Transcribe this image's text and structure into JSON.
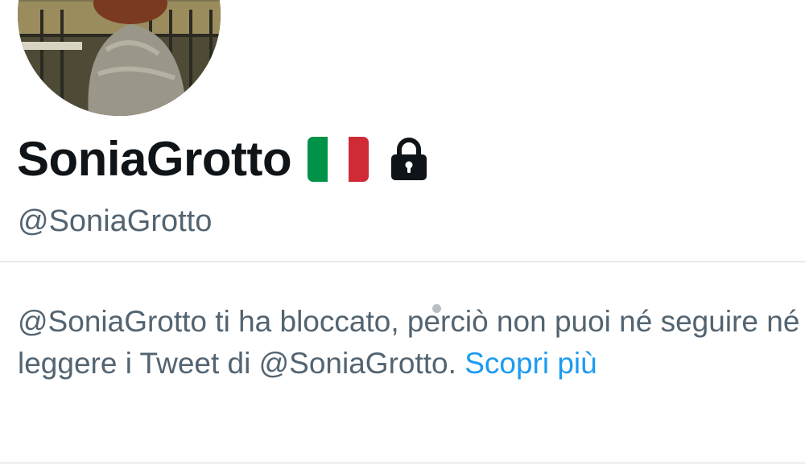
{
  "profile": {
    "display_name": "SoniaGrotto",
    "handle": "@SoniaGrotto",
    "flag_icon": "italy-flag-icon",
    "lock_icon": "lock-icon",
    "flag_colors": [
      "#009246",
      "#ffffff",
      "#ce2b37"
    ]
  },
  "block_notice": {
    "text": "@SoniaGrotto ti ha bloccato, perciò non puoi né seguire né leggere i Tweet di @SoniaGrotto.",
    "link_label": "Scopri più"
  },
  "colors": {
    "text_primary": "#0f1419",
    "text_secondary": "#536471",
    "link": "#1d9bf0",
    "divider": "#cfd9de"
  }
}
